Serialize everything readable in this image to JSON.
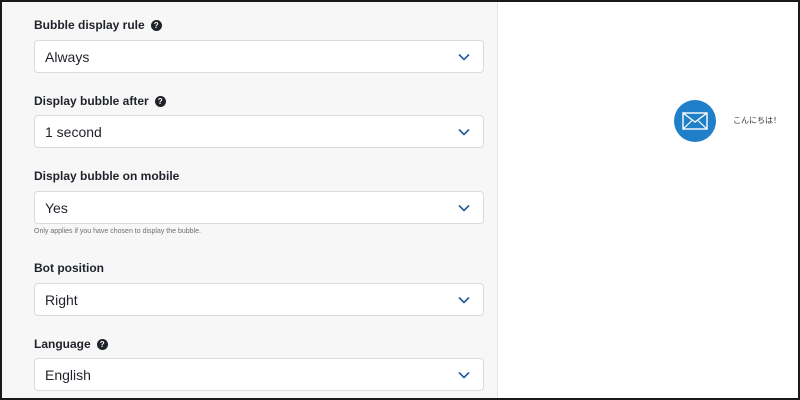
{
  "settings": {
    "bubble_display_rule": {
      "label": "Bubble display rule",
      "value": "Always",
      "has_help": true
    },
    "display_bubble_after": {
      "label": "Display bubble after",
      "value": "1 second",
      "has_help": true
    },
    "display_bubble_on_mobile": {
      "label": "Display bubble on mobile",
      "value": "Yes",
      "hint": "Only applies if you have chosen to display the bubble."
    },
    "bot_position": {
      "label": "Bot position",
      "value": "Right"
    },
    "language": {
      "label": "Language",
      "value": "English",
      "has_help": true
    }
  },
  "preview": {
    "bubble_icon": "envelope-icon",
    "bubble_text": "こんにちは！"
  },
  "colors": {
    "bubble": "#1f7fc9",
    "chevron": "#1f5f9e",
    "panel_bg": "#f7f7f8"
  }
}
